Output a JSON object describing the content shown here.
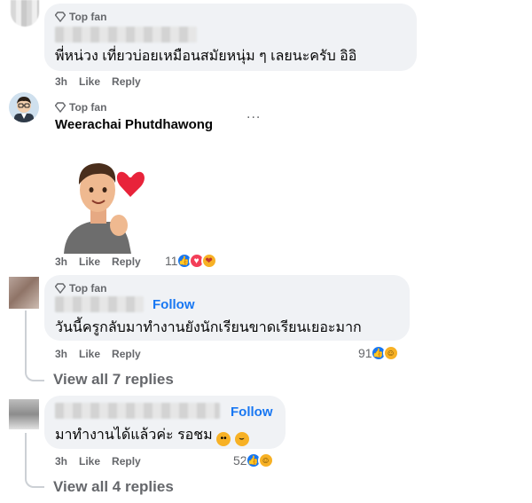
{
  "badge_label": "Top fan",
  "comments": [
    {
      "text": "พี่หน่วง เที่ยวบ่อยเหมือนสมัยหนุ่ม ๆ เลยนะครับ อิอิ",
      "time": "3h",
      "like": "Like",
      "reply": "Reply"
    },
    {
      "name": "Weerachai Phutdhawong",
      "more": "...",
      "time": "3h",
      "like": "Like",
      "reply": "Reply",
      "reaction_count": "11"
    },
    {
      "follow": "Follow",
      "text": "วันนี้ครูกลับมาทำงานยังนักเรียนขาดเรียนเยอะมาก",
      "time": "3h",
      "like": "Like",
      "reply": "Reply",
      "reaction_count": "91",
      "view_replies": "View all 7 replies"
    },
    {
      "follow": "Follow",
      "text": "มาทำงานได้แล้วค่ะ รอชม",
      "time": "3h",
      "like": "Like",
      "reply": "Reply",
      "reaction_count": "52",
      "view_replies": "View all 4 replies"
    }
  ],
  "colors": {
    "bubble": "#f0f2f5",
    "secondary_text": "#65676b",
    "follow": "#1877f2",
    "like": "#1877f2",
    "love": "#f33e58",
    "haha": "#f7b125"
  },
  "icons": [
    "diamond-icon",
    "like-reaction-icon",
    "love-reaction-icon",
    "haha-reaction-icon",
    "care-reaction-icon"
  ]
}
